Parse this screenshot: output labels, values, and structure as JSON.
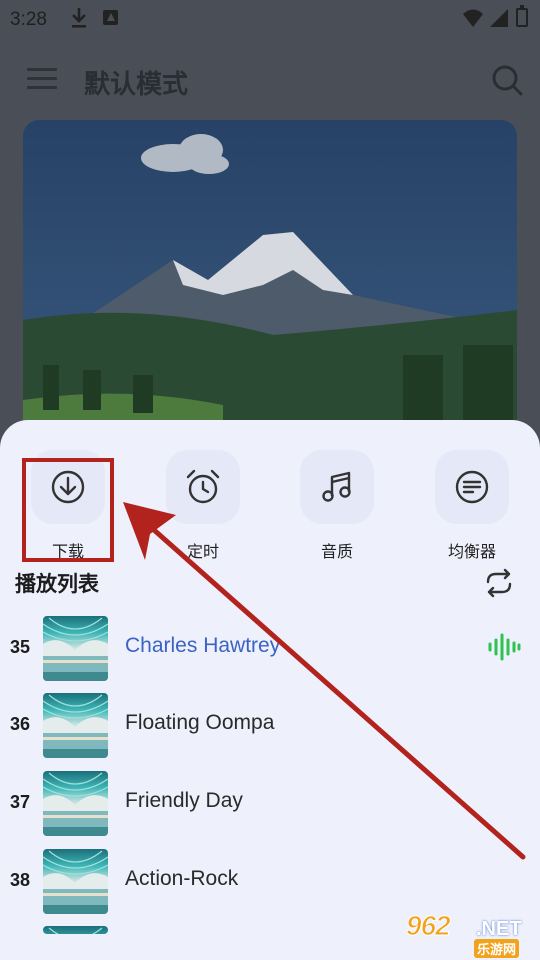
{
  "status_bar": {
    "time": "3:28",
    "icons": [
      "download-icon",
      "a-icon",
      "wifi-icon",
      "signal-icon",
      "battery-icon"
    ]
  },
  "app_bar": {
    "title": "默认模式",
    "icons": [
      "menu-icon",
      "search-icon"
    ]
  },
  "actions": [
    {
      "label": "下载",
      "icon": "download-icon"
    },
    {
      "label": "定时",
      "icon": "alarm-clock-icon"
    },
    {
      "label": "音质",
      "icon": "music-note-icon"
    },
    {
      "label": "均衡器",
      "icon": "equalizer-icon"
    }
  ],
  "playlist": {
    "title": "播放列表",
    "tracks": [
      {
        "number": "35",
        "title": "Charles Hawtrey",
        "playing": true
      },
      {
        "number": "36",
        "title": "Floating Oompa",
        "playing": false
      },
      {
        "number": "37",
        "title": "Friendly Day",
        "playing": false
      },
      {
        "number": "38",
        "title": "Action-Rock",
        "playing": false
      }
    ]
  },
  "watermark": {
    "number": "962",
    "domain": ".NET",
    "site": "乐游网"
  },
  "colors": {
    "accent": "#3a63c4",
    "playing_wave": "#2ec24f",
    "annotation": "#b3231d",
    "sheet": "#eef0fb"
  }
}
